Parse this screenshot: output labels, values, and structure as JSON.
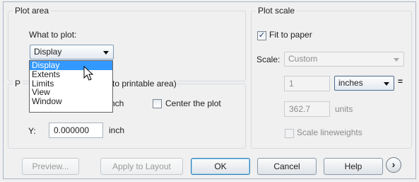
{
  "plot_area": {
    "legend": "Plot area",
    "what_to_plot_label": "What to plot:",
    "selected": "Display",
    "options": [
      "Display",
      "Extents",
      "Limits",
      "View",
      "Window"
    ],
    "hidden_offset_legend_start": "P",
    "offset_legend_visible": "to printable area)"
  },
  "plot_offset": {
    "x_unit": "nch",
    "center_label": "Center the plot",
    "center_checked": false,
    "y_label": "Y:",
    "y_value": "0.000000",
    "y_unit": "inch"
  },
  "plot_scale": {
    "legend": "Plot scale",
    "fit_to_paper_label": "Fit to paper",
    "fit_to_paper_checked": true,
    "scale_label": "Scale:",
    "scale_value": "Custom",
    "paper_value": "1",
    "paper_unit": "inches",
    "equals": "=",
    "drawing_value": "362.7",
    "drawing_unit": "units",
    "lineweights_label": "Scale lineweights",
    "lineweights_checked": false
  },
  "buttons": {
    "preview": "Preview...",
    "apply": "Apply to Layout",
    "ok": "OK",
    "cancel": "Cancel",
    "help": "Help",
    "more": "›"
  }
}
